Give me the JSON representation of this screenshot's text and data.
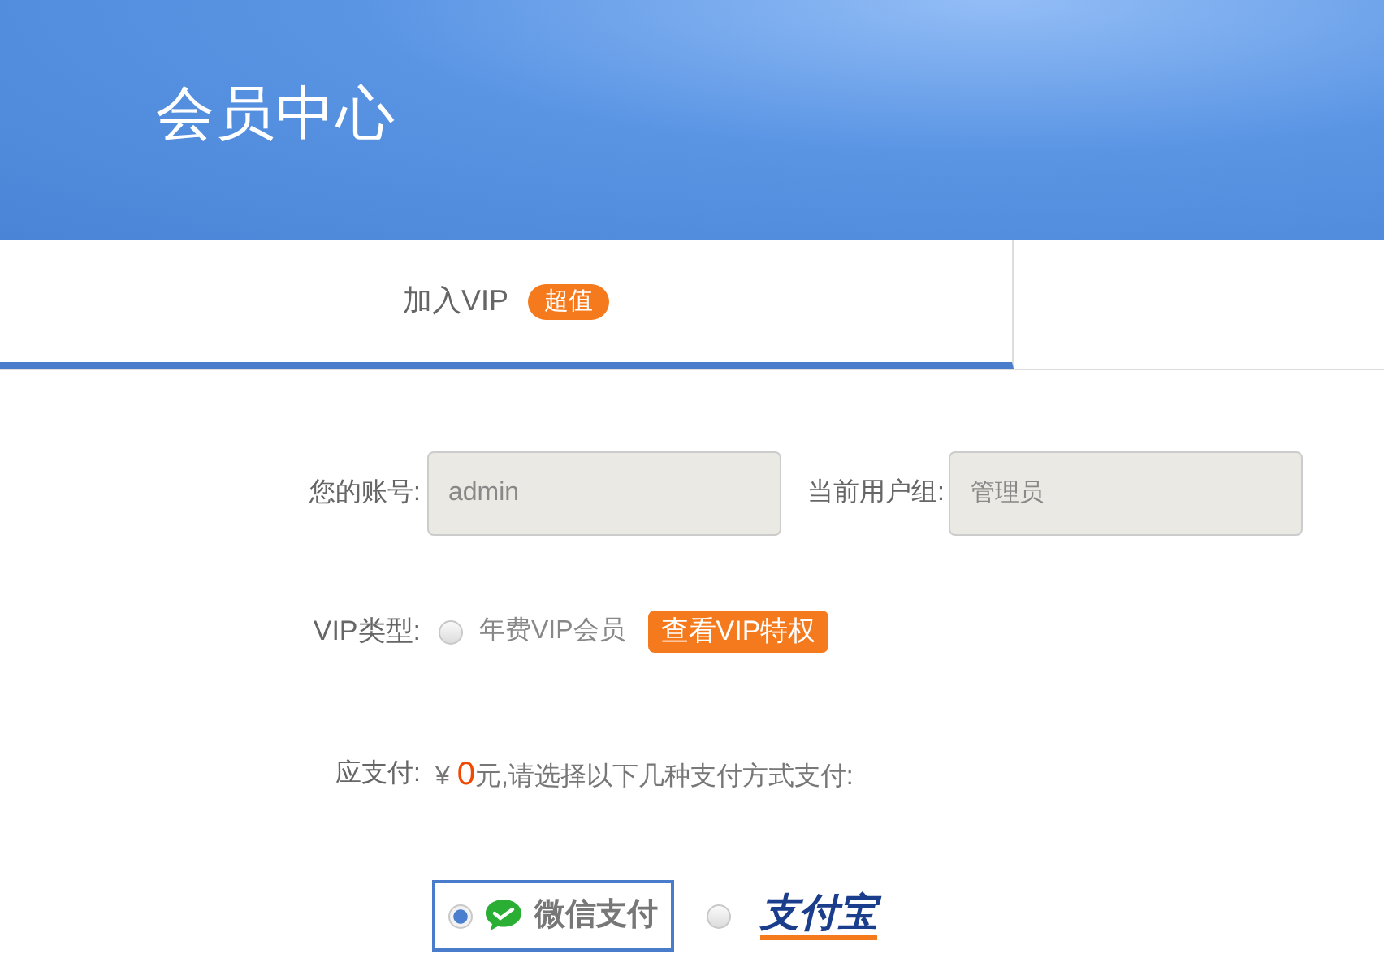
{
  "header": {
    "title": "会员中心"
  },
  "tabs": [
    {
      "label": "加入VIP",
      "badge": "超值",
      "selected": true
    }
  ],
  "account": {
    "label": "您的账号:",
    "value": "admin"
  },
  "group": {
    "label": "当前用户组:",
    "value": "管理员"
  },
  "vip_type": {
    "label": "VIP类型:",
    "options": [
      {
        "label": "年费VIP会员",
        "selected": false
      }
    ],
    "link": "查看VIP特权"
  },
  "payment": {
    "label": "应支付:",
    "currency": "¥",
    "amount": "0",
    "note": "元,请选择以下几种支付方式支付:"
  },
  "methods": [
    {
      "kind": "wechat",
      "label": "微信支付",
      "selected": true
    },
    {
      "kind": "alipay",
      "label": "支付宝",
      "selected": false
    }
  ]
}
